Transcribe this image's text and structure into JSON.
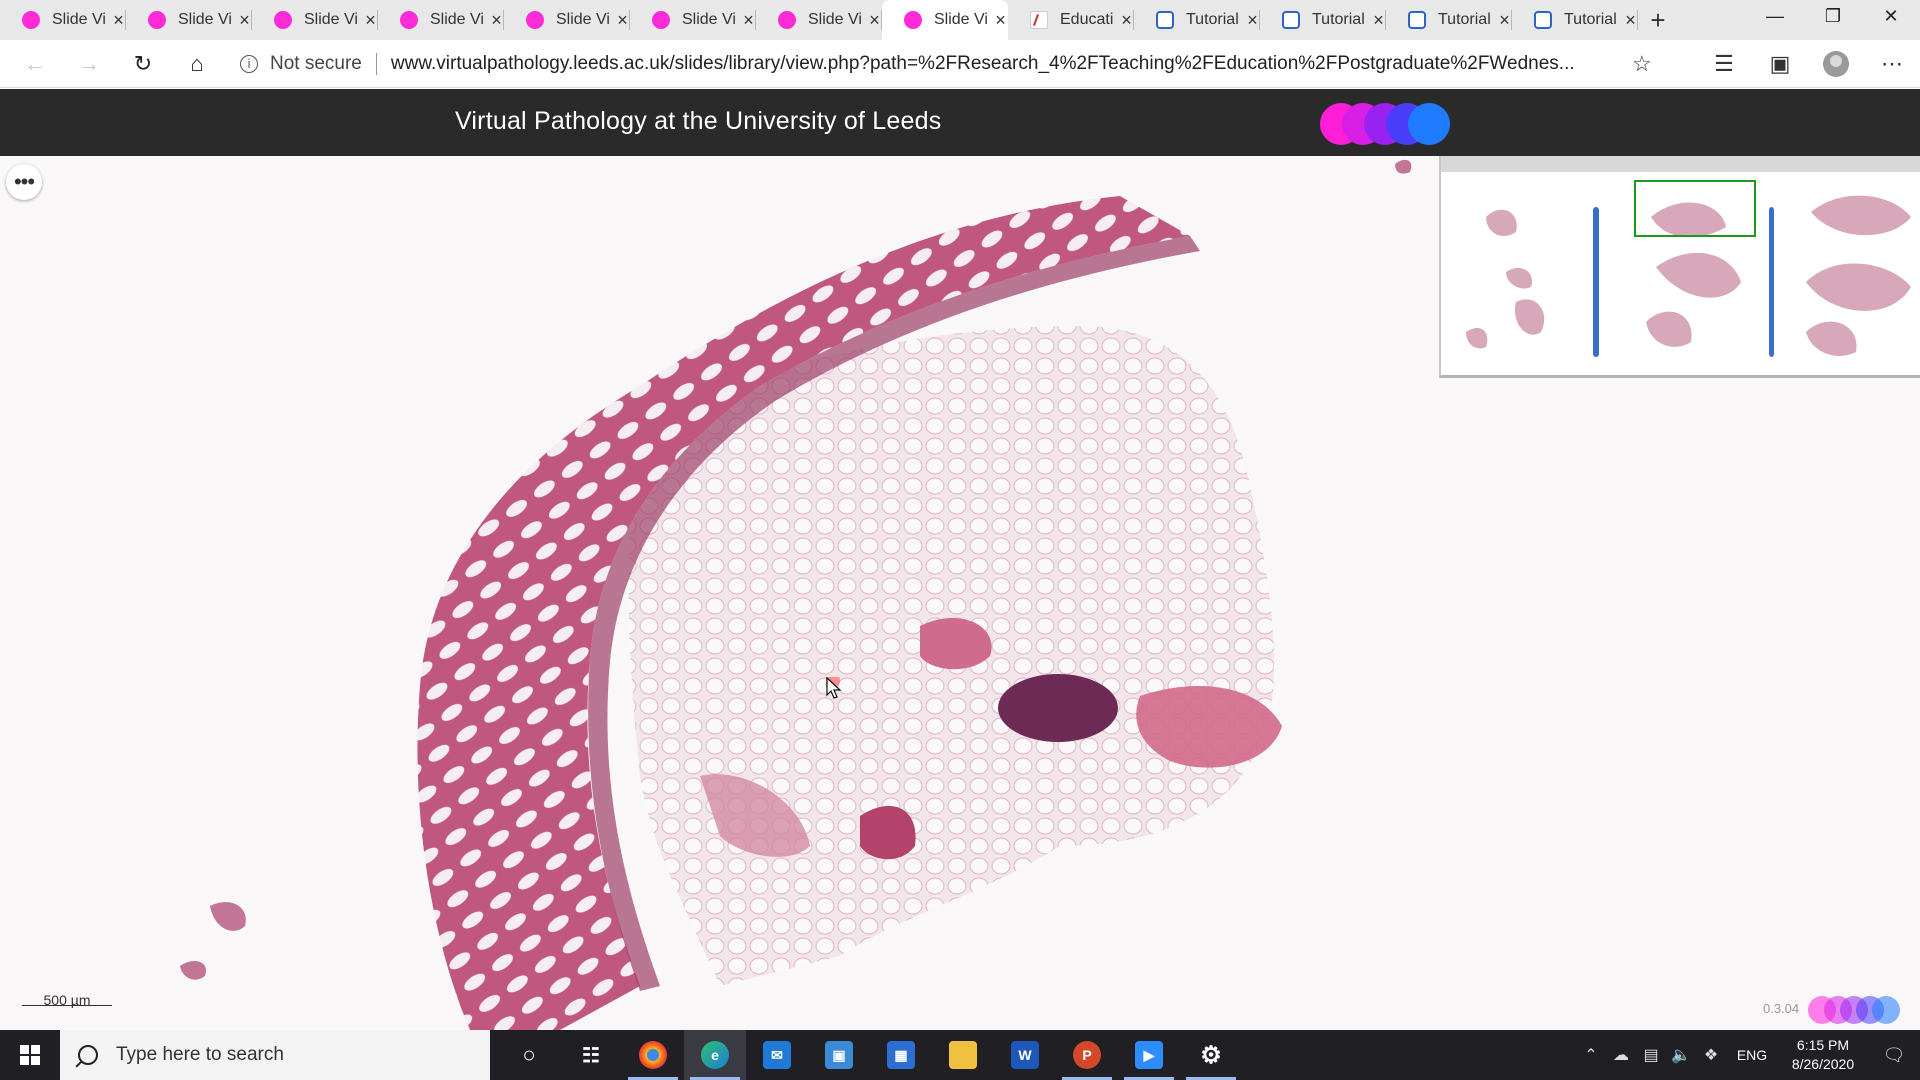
{
  "browser": {
    "tabs": [
      {
        "title": "Slide Viewer",
        "icon": "slide-viewer-icon",
        "active": false
      },
      {
        "title": "Slide Viewer",
        "icon": "slide-viewer-icon",
        "active": false
      },
      {
        "title": "Slide Viewer",
        "icon": "slide-viewer-icon",
        "active": false
      },
      {
        "title": "Slide Viewer",
        "icon": "slide-viewer-icon",
        "active": false
      },
      {
        "title": "Slide Viewer",
        "icon": "slide-viewer-icon",
        "active": false
      },
      {
        "title": "Slide Viewer",
        "icon": "slide-viewer-icon",
        "active": false
      },
      {
        "title": "Slide Viewer",
        "icon": "slide-viewer-icon",
        "active": false
      },
      {
        "title": "Slide Viewer",
        "icon": "slide-viewer-icon",
        "active": true
      },
      {
        "title": "Education",
        "icon": "education-icon",
        "active": false
      },
      {
        "title": "Tutorial",
        "icon": "tutorial-icon",
        "active": false
      },
      {
        "title": "Tutorial",
        "icon": "tutorial-icon",
        "active": false
      },
      {
        "title": "Tutorial",
        "icon": "tutorial-icon",
        "active": false
      },
      {
        "title": "Tutorial",
        "icon": "tutorial-icon",
        "active": false
      }
    ],
    "security_label": "Not secure",
    "url": "www.virtualpathology.leeds.ac.uk/slides/library/view.php?path=%2FResearch_4%2FTeaching%2FEducation%2FPostgraduate%2FWednes..."
  },
  "site": {
    "title": "Virtual Pathology at the University of Leeds",
    "logo_colors": [
      "#ff1fd9",
      "#d81fe6",
      "#9a22f0",
      "#4a3dfa",
      "#1f7cff"
    ]
  },
  "viewer": {
    "scale_label": "500 µm",
    "version": "0.3.04"
  },
  "taskbar": {
    "search_placeholder": "Type here to search",
    "apps": [
      "cortana-icon",
      "task-view-icon",
      "chrome-icon",
      "edge-icon",
      "mail-icon",
      "remote-desktop-icon",
      "store-icon",
      "file-explorer-icon",
      "word-icon",
      "powerpoint-icon",
      "zoom-icon",
      "settings-icon"
    ],
    "language": "ENG",
    "time": "6:15 PM",
    "date": "8/26/2020"
  }
}
